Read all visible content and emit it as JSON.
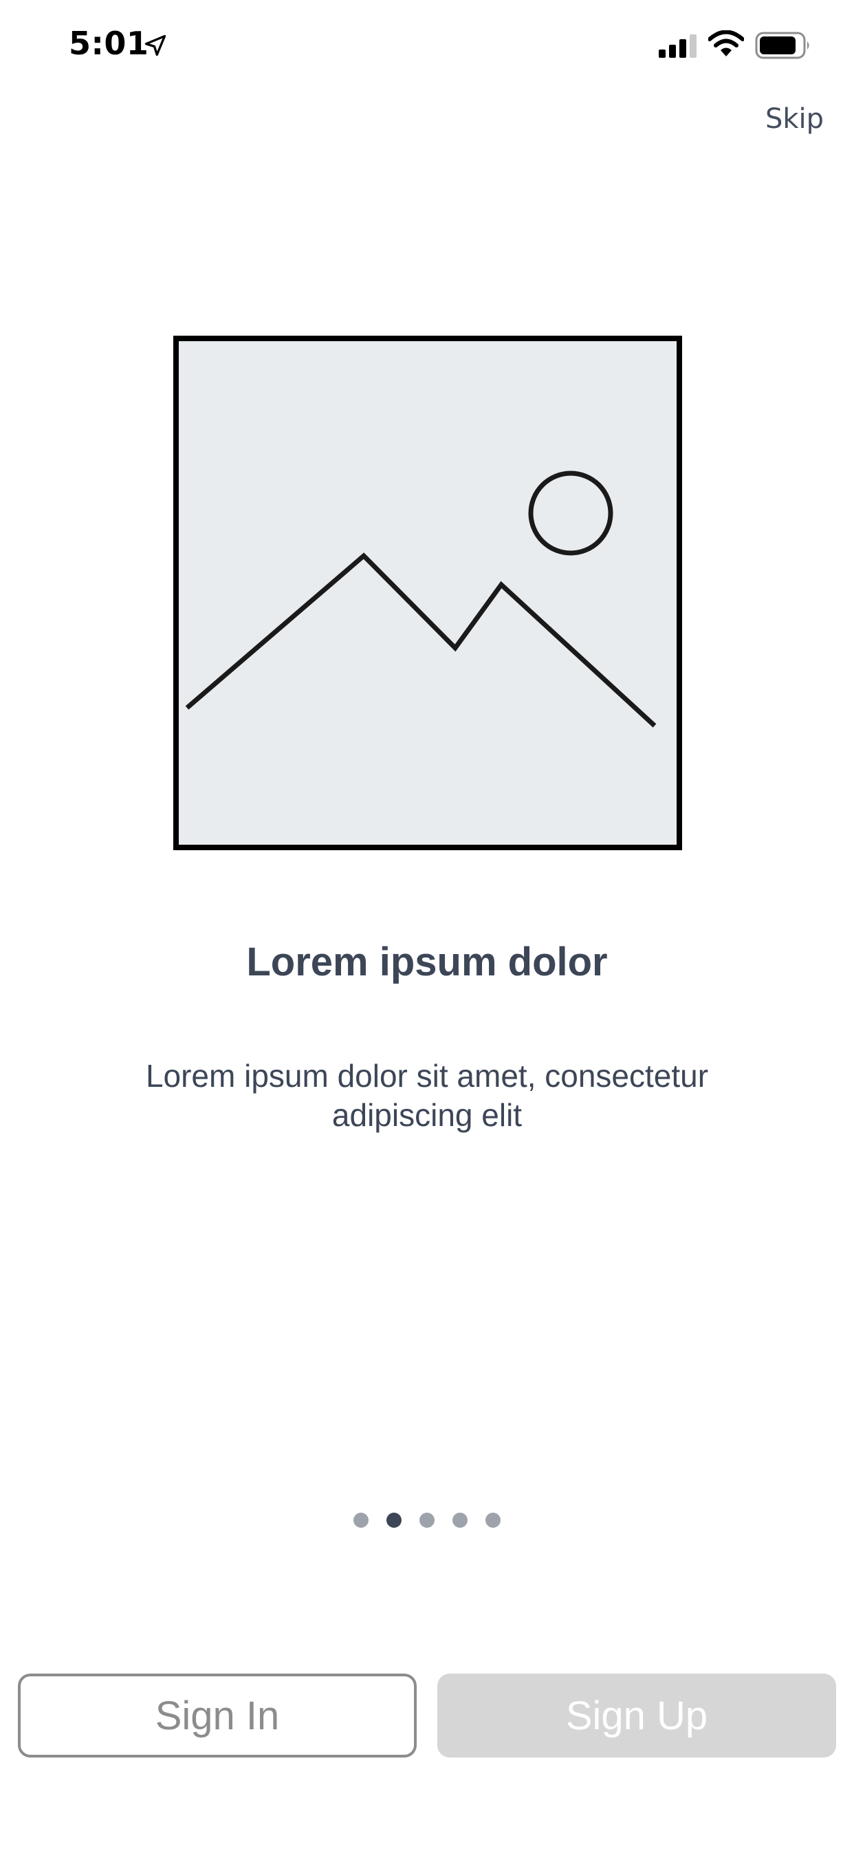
{
  "status_bar": {
    "time": "5:01",
    "icons": [
      "location-arrow-icon",
      "cellular-signal-icon",
      "wifi-icon",
      "battery-icon"
    ]
  },
  "header": {
    "skip_label": "Skip"
  },
  "illustration": {
    "icon": "image-placeholder-icon"
  },
  "content": {
    "title": "Lorem ipsum dolor",
    "subtitle": "Lorem ipsum dolor sit amet, consectetur adipiscing elit"
  },
  "pagination": {
    "total": 5,
    "current": 2
  },
  "actions": {
    "sign_in_label": "Sign In",
    "sign_up_label": "Sign Up"
  },
  "colors": {
    "text_primary": "#3d4657",
    "dot_inactive": "#9ea3ab",
    "dot_active": "#3d4657",
    "placeholder_fill": "#e9ecee",
    "sign_in_border": "#8c8c8c",
    "sign_up_bg": "#d6d6d6"
  }
}
